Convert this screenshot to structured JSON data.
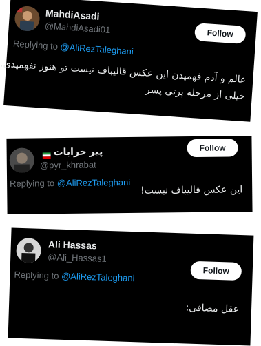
{
  "tweets": [
    {
      "name": "MahdiAsadi",
      "handle": "@MahdiAsadi01",
      "follow_label": "Follow",
      "replying_prefix": "Replying to",
      "replying_to": "@AliRezTaleghani",
      "lines": [
        "عالم و آدم فهمیدن این عکس قالیباف نیست تو هنوز نفهمیدی.",
        "خیلی از مرحله پرتی پسر"
      ]
    },
    {
      "name": "پیر خرابات",
      "handle": "@pyr_khrabat",
      "follow_label": "Follow",
      "replying_prefix": "Replying to",
      "replying_to": "@AliRezTaleghani",
      "lines": [
        "این عکس قالیباف نیست!"
      ]
    },
    {
      "name": "Ali Hassas",
      "handle": "@Ali_Hassas1",
      "follow_label": "Follow",
      "replying_prefix": "Replying to",
      "replying_to": "@AliRezTaleghani",
      "lines": [
        "عقل مصافی:"
      ]
    }
  ],
  "colors": {
    "card_bg": "#000000",
    "mention": "#1d9bf0",
    "muted": "#71767b",
    "follow_bg": "#ffffff"
  },
  "icons": [
    "avatar-icon",
    "iran-flag-icon"
  ]
}
